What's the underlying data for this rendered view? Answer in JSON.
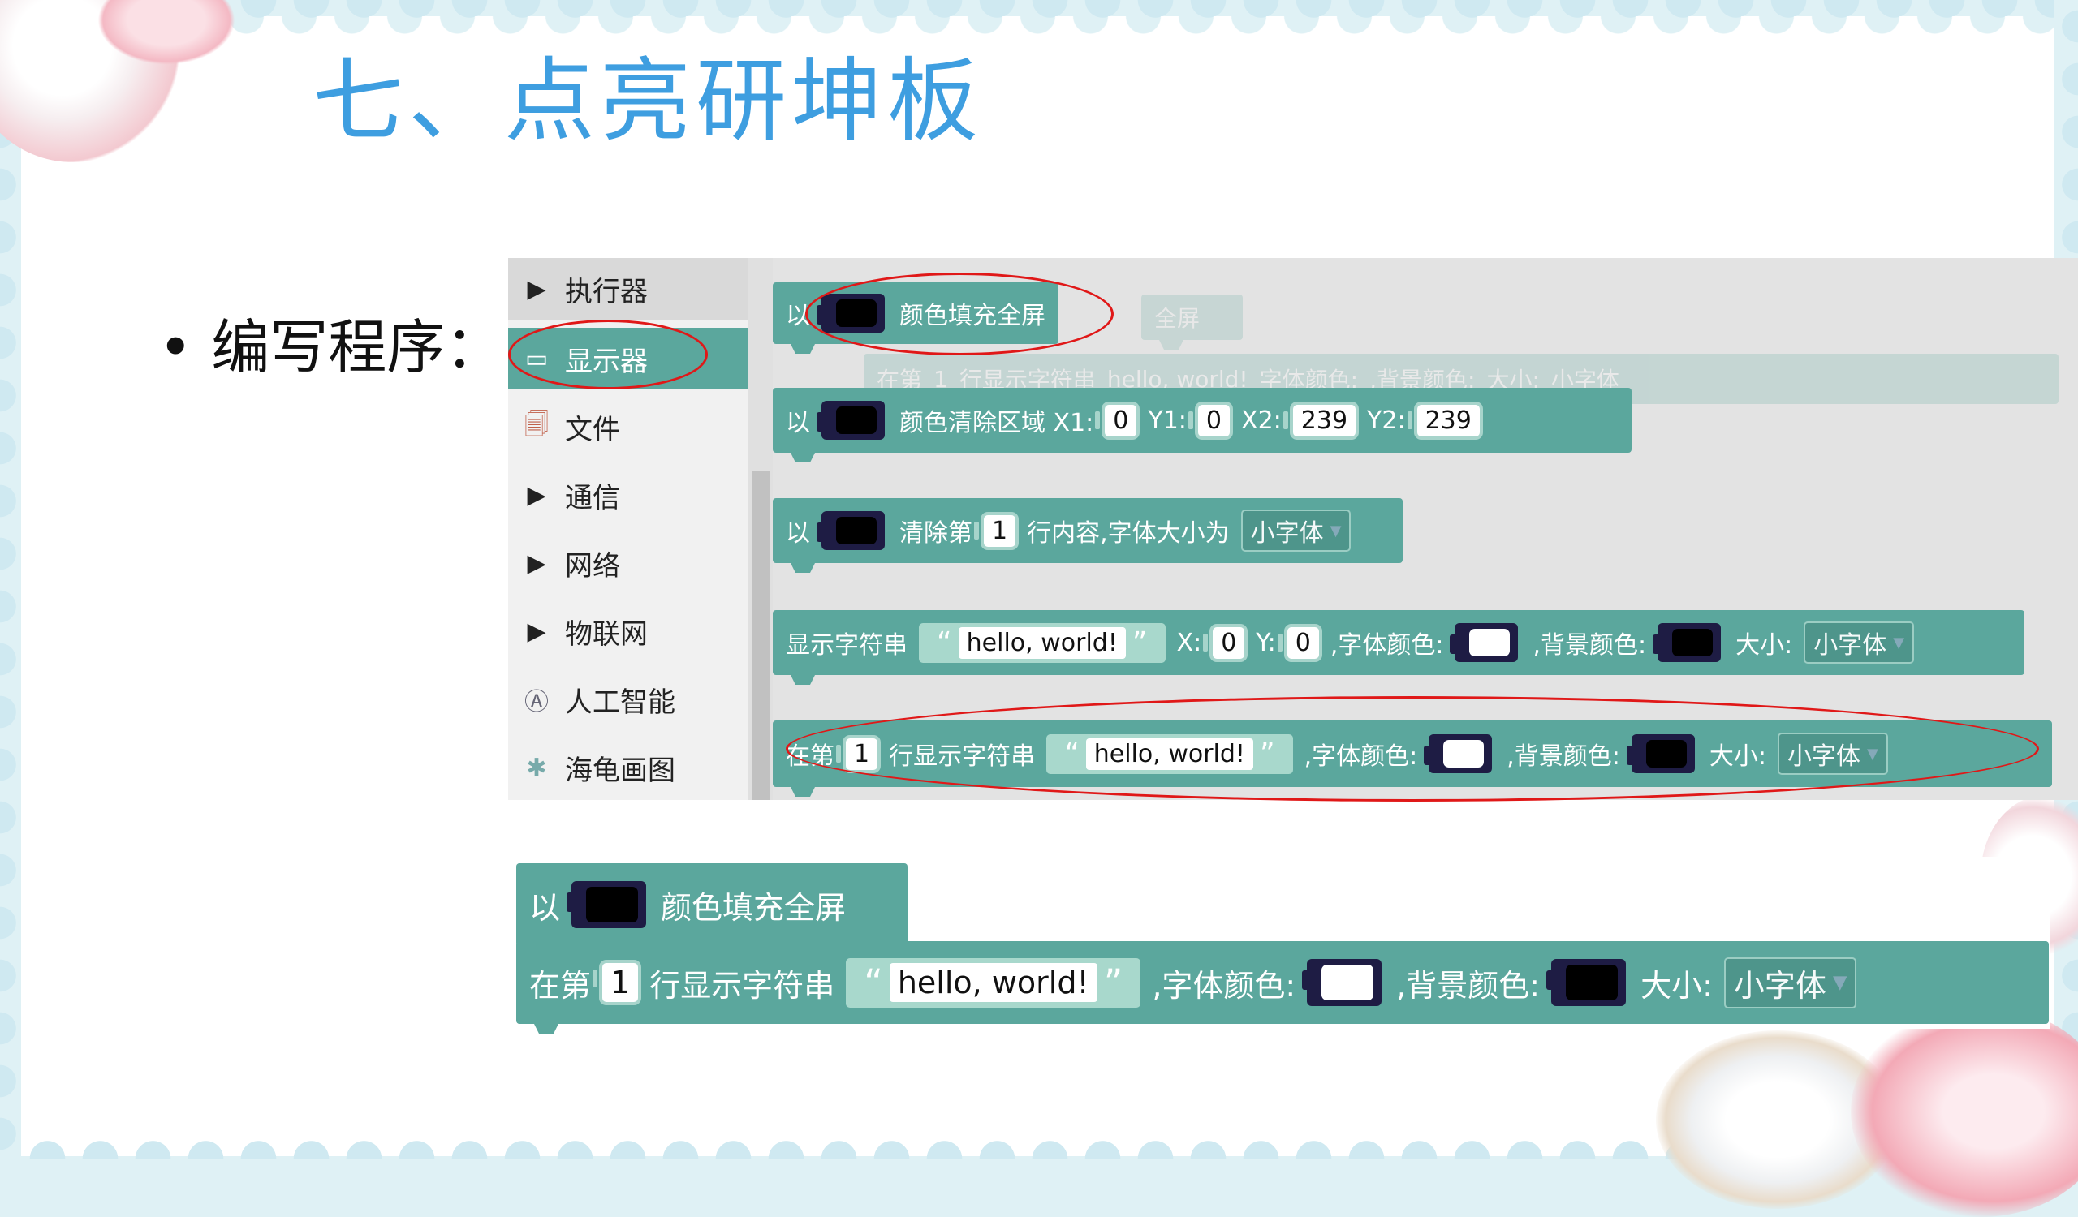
{
  "slide": {
    "title": "七、点亮研坤板",
    "bullet": "• 编写程序："
  },
  "sidebar": {
    "items": [
      {
        "label": "执行器",
        "icon": "▶",
        "icon_name": "play-triangle-icon"
      },
      {
        "label": "显示器",
        "icon": "▭",
        "icon_name": "monitor-icon"
      },
      {
        "label": "文件",
        "icon": "🗐",
        "icon_name": "file-icon"
      },
      {
        "label": "通信",
        "icon": "▶",
        "icon_name": "play-triangle-icon"
      },
      {
        "label": "网络",
        "icon": "▶",
        "icon_name": "play-triangle-icon"
      },
      {
        "label": "物联网",
        "icon": "▶",
        "icon_name": "play-triangle-icon"
      },
      {
        "label": "人工智能",
        "icon": "Ⓐ",
        "icon_name": "ai-icon"
      },
      {
        "label": "海龟画图",
        "icon": "✱",
        "icon_name": "turtle-icon"
      }
    ]
  },
  "blocks": {
    "fill": {
      "prefix": "以",
      "text": "颜色填充全屏"
    },
    "clear_area": {
      "prefix": "以",
      "text": "颜色清除区域 X1:",
      "x1": "0",
      "y1_label": "Y1:",
      "y1": "0",
      "x2_label": "X2:",
      "x2": "239",
      "y2_label": "Y2:",
      "y2": "239"
    },
    "clear_line": {
      "prefix": "以",
      "text": "清除第",
      "line": "1",
      "text2": "行内容,字体大小为",
      "size": "小字体"
    },
    "show_str": {
      "text": "显示字符串",
      "q_open": "“",
      "value": "hello, world!",
      "q_close": "”",
      "x_label": "X:",
      "x": "0",
      "y_label": "Y:",
      "y": "0",
      "font_color_label": ",字体颜色:",
      "bg_color_label": ",背景颜色:",
      "size_label": "大小:",
      "size": "小字体"
    },
    "line_str": {
      "prefix": "在第",
      "line": "1",
      "text": "行显示字符串",
      "q_open": "“",
      "value": "hello, world!",
      "q_close": "”",
      "font_color_label": ",字体颜色:",
      "bg_color_label": ",背景颜色:",
      "size_label": "大小:",
      "size": "小字体"
    },
    "ghost": {
      "prefix": "在第",
      "line": "1",
      "text": "行显示字符串",
      "value": "hello, world!",
      "font_color_label": "字体颜色:",
      "bg_color_label": ",背景颜色:",
      "size_label": "大小:",
      "size": "小字体",
      "fill_tail": "全屏"
    }
  },
  "colors": {
    "block": "#5ba79d",
    "title": "#3e9ee0",
    "highlight": "#e01818"
  }
}
